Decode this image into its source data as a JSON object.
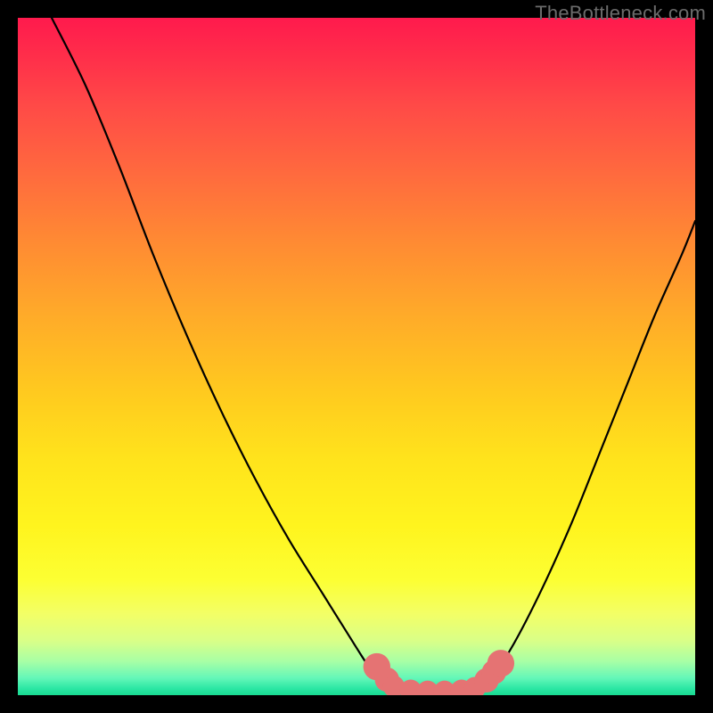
{
  "watermark": "TheBottleneck.com",
  "colors": {
    "frame": "#000000",
    "curve_stroke": "#000000",
    "marker_fill": "#e57373",
    "marker_stroke": "#d96868"
  },
  "chart_data": {
    "type": "line",
    "title": "",
    "xlabel": "",
    "ylabel": "",
    "xlim": [
      0,
      100
    ],
    "ylim": [
      0,
      100
    ],
    "grid": false,
    "legend": false,
    "note": "No axis tick labels or numeric labels are visible; values are estimated proportions of the plot area (0–100).",
    "series": [
      {
        "name": "left-curve",
        "x": [
          5,
          10,
          15,
          20,
          25,
          30,
          35,
          40,
          45,
          50,
          52,
          54,
          55.5
        ],
        "y": [
          100,
          90,
          78,
          65,
          53,
          42,
          32,
          23,
          15,
          7,
          4,
          2,
          1
        ]
      },
      {
        "name": "valley-flat",
        "x": [
          55.5,
          58,
          61,
          64,
          67,
          68.5
        ],
        "y": [
          1,
          0.5,
          0.4,
          0.4,
          0.6,
          1
        ]
      },
      {
        "name": "right-curve",
        "x": [
          68.5,
          71,
          74,
          78,
          82,
          86,
          90,
          94,
          98,
          100
        ],
        "y": [
          1,
          4,
          9,
          17,
          26,
          36,
          46,
          56,
          65,
          70
        ]
      }
    ],
    "markers": [
      {
        "x": 53.0,
        "y": 4.2,
        "r": 2.0
      },
      {
        "x": 54.5,
        "y": 2.3,
        "r": 1.8
      },
      {
        "x": 55.5,
        "y": 1.3,
        "r": 1.6
      },
      {
        "x": 58.0,
        "y": 0.7,
        "r": 1.6
      },
      {
        "x": 60.5,
        "y": 0.55,
        "r": 1.6
      },
      {
        "x": 63.0,
        "y": 0.55,
        "r": 1.6
      },
      {
        "x": 65.5,
        "y": 0.7,
        "r": 1.6
      },
      {
        "x": 67.5,
        "y": 1.1,
        "r": 1.6
      },
      {
        "x": 69.2,
        "y": 2.2,
        "r": 1.8
      },
      {
        "x": 70.3,
        "y": 3.4,
        "r": 1.8
      },
      {
        "x": 71.3,
        "y": 4.7,
        "r": 2.0
      }
    ]
  }
}
